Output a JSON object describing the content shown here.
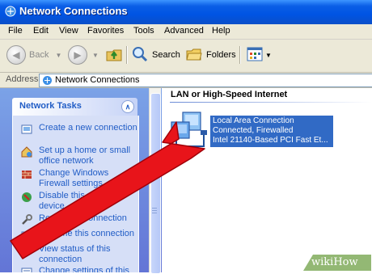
{
  "window": {
    "title": "Network Connections",
    "icon": "network-connections-icon"
  },
  "menu": {
    "items": [
      "File",
      "Edit",
      "View",
      "Favorites",
      "Tools",
      "Advanced",
      "Help"
    ]
  },
  "toolbar": {
    "back_label": "Back",
    "search_label": "Search",
    "folders_label": "Folders"
  },
  "address": {
    "label": "Address",
    "value": "Network Connections"
  },
  "sidebar": {
    "panel_title": "Network Tasks",
    "tasks": [
      {
        "label": "Create a new connection",
        "icon": "new-connection-icon"
      },
      {
        "label": "Set up a home or small office network",
        "icon": "home-network-icon"
      },
      {
        "label": "Change Windows Firewall settings",
        "icon": "firewall-icon"
      },
      {
        "label": "Disable this network device",
        "icon": "disable-device-icon"
      },
      {
        "label": "Repair this connection",
        "icon": "repair-icon"
      },
      {
        "label": "Rename this connection",
        "icon": "rename-icon"
      },
      {
        "label": "View status of this connection",
        "icon": "status-icon"
      },
      {
        "label": "Change settings of this",
        "icon": "settings-icon"
      }
    ]
  },
  "content": {
    "group_title": "LAN or High-Speed Internet",
    "connection": {
      "name": "Local Area Connection",
      "status": "Connected, Firewalled",
      "device": "Intel 21140-Based PCI Fast Et..."
    }
  },
  "watermark": {
    "brand": "wikiHow"
  },
  "colors": {
    "xp_blue": "#0054e3",
    "selection": "#316ac5",
    "task_link": "#215dc6",
    "arrow_red": "#e8141a"
  }
}
